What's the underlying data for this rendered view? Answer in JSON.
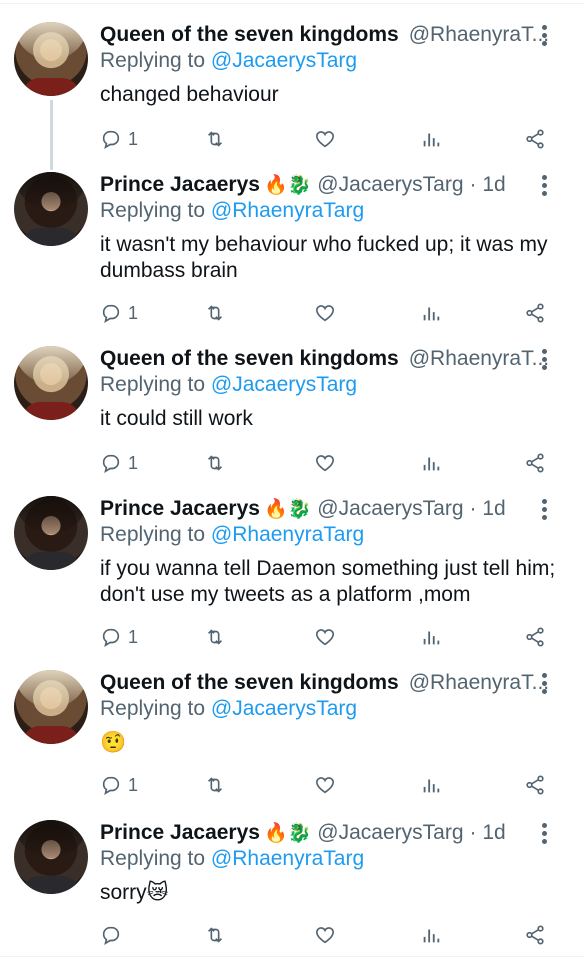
{
  "tweets": [
    {
      "author": "Queen of the seven kingdoms",
      "emoji": "",
      "handle": "@RhaenyraT...",
      "time": "",
      "replying_prefix": "Replying to",
      "replying_to": "@JacaerysTarg",
      "text": "changed behaviour",
      "reply_count": "1",
      "avatar_icon": "queen-avatar"
    },
    {
      "author": "Prince Jacaerys",
      "emoji": "🔥🐉",
      "handle": "@JacaerysTarg",
      "time": "· 1d",
      "replying_prefix": "Replying to",
      "replying_to": "@RhaenyraTarg",
      "text": "it wasn't my behaviour who fucked up; it was my dumbass brain",
      "reply_count": "1",
      "avatar_icon": "prince-avatar"
    },
    {
      "author": "Queen of the seven kingdoms",
      "emoji": "",
      "handle": "@RhaenyraT...",
      "time": "",
      "replying_prefix": "Replying to",
      "replying_to": "@JacaerysTarg",
      "text": "it could still work",
      "reply_count": "1",
      "avatar_icon": "queen-avatar"
    },
    {
      "author": "Prince Jacaerys",
      "emoji": "🔥🐉",
      "handle": "@JacaerysTarg",
      "time": "· 1d",
      "replying_prefix": "Replying to",
      "replying_to": "@RhaenyraTarg",
      "text": "if you wanna tell Daemon something just tell him; don't use my tweets as a platform ,mom",
      "reply_count": "1",
      "avatar_icon": "prince-avatar"
    },
    {
      "author": "Queen of the seven kingdoms",
      "emoji": "",
      "handle": "@RhaenyraT...",
      "time": "",
      "replying_prefix": "Replying to",
      "replying_to": "@JacaerysTarg",
      "text": "🤨",
      "reply_count": "1",
      "avatar_icon": "queen-avatar"
    },
    {
      "author": "Prince Jacaerys",
      "emoji": "🔥🐉",
      "handle": "@JacaerysTarg",
      "time": "· 1d",
      "replying_prefix": "Replying to",
      "replying_to": "@RhaenyraTarg",
      "text": "sorry😿",
      "reply_count": "",
      "avatar_icon": "prince-avatar"
    }
  ],
  "icons": {
    "reply": "reply-icon",
    "retweet": "retweet-icon",
    "like": "heart-icon",
    "views": "views-icon",
    "share": "share-icon",
    "more": "more-icon"
  },
  "colors": {
    "link": "#1d9bf0",
    "muted": "#536471",
    "thread": "#cfd9de"
  }
}
